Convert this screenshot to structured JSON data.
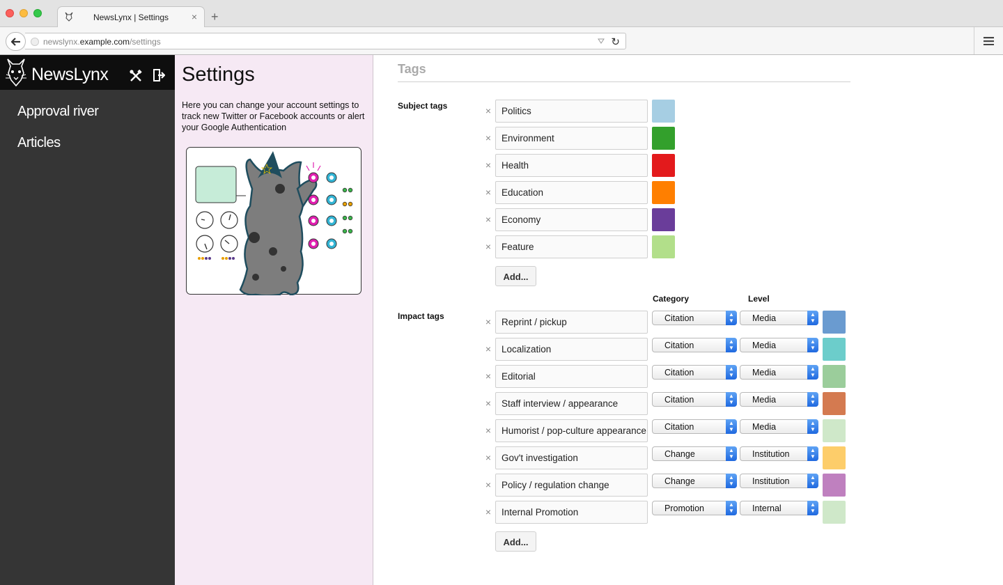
{
  "browser": {
    "tab_title": "NewsLynx | Settings",
    "url_domain_prefix": "newslynx.",
    "url_domain": "example.com",
    "url_path": "/settings"
  },
  "app": {
    "name": "NewsLynx",
    "nav": [
      "Approval river",
      "Articles"
    ]
  },
  "settings": {
    "title": "Settings",
    "description": "Here you can change your account settings to track new Twitter or Facebook accounts or alert your Google Authentication"
  },
  "tags": {
    "title": "Tags",
    "subject_label": "Subject tags",
    "subject": [
      {
        "name": "Politics",
        "color": "#a6cee3"
      },
      {
        "name": "Environment",
        "color": "#33a02c"
      },
      {
        "name": "Health",
        "color": "#e31a1c"
      },
      {
        "name": "Education",
        "color": "#ff7f00"
      },
      {
        "name": "Economy",
        "color": "#6a3d9a"
      },
      {
        "name": "Feature",
        "color": "#b2df8a"
      }
    ],
    "add_label": "Add...",
    "impact_label": "Impact tags",
    "category_header": "Category",
    "level_header": "Level",
    "impact": [
      {
        "name": "Reprint / pickup",
        "category": "Citation",
        "level": "Media",
        "color": "#6a9bd0"
      },
      {
        "name": "Localization",
        "category": "Citation",
        "level": "Media",
        "color": "#6ccdcb"
      },
      {
        "name": "Editorial",
        "category": "Citation",
        "level": "Media",
        "color": "#9bcd9b"
      },
      {
        "name": "Staff interview / appearance",
        "category": "Citation",
        "level": "Media",
        "color": "#d47a50"
      },
      {
        "name": "Humorist / pop-culture appearance",
        "category": "Citation",
        "level": "Media",
        "color": "#cfe8c9"
      },
      {
        "name": "Gov't investigation",
        "category": "Change",
        "level": "Institution",
        "color": "#fdcd6a"
      },
      {
        "name": "Policy / regulation change",
        "category": "Change",
        "level": "Institution",
        "color": "#bf80bf"
      },
      {
        "name": "Internal Promotion",
        "category": "Promotion",
        "level": "Internal",
        "color": "#cfe8c9"
      }
    ]
  }
}
